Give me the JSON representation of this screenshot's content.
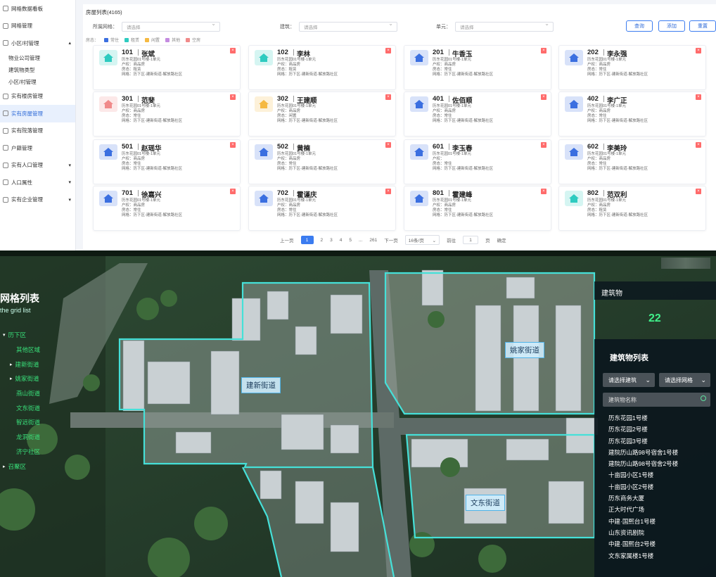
{
  "sidebar": {
    "items": [
      {
        "label": "网格数据看板"
      },
      {
        "label": "网格管理"
      },
      {
        "label": "小区/村管理"
      },
      {
        "label": "物业公司管理"
      },
      {
        "label": "建筑物类型"
      },
      {
        "label": "小区/村管理"
      },
      {
        "label": "实有楼房管理"
      },
      {
        "label": "实有房屋管理"
      },
      {
        "label": "实有院落管理"
      },
      {
        "label": "户籍管理"
      },
      {
        "label": "实有人口管理"
      },
      {
        "label": "人口属性"
      },
      {
        "label": "实有企业管理"
      }
    ]
  },
  "house_list": {
    "title": "房屋列表(4165)",
    "filters": [
      {
        "label": "所属网格：",
        "placeholder": "请选择"
      },
      {
        "label": "建筑：",
        "placeholder": "请选择"
      },
      {
        "label": "单元：",
        "placeholder": "请选择"
      }
    ],
    "buttons": {
      "query": "查询",
      "add": "添加",
      "reset": "重置"
    },
    "legend": {
      "label": "房态：",
      "items": [
        {
          "label": "常住",
          "color": "#3b6fe0"
        },
        {
          "label": "租赁",
          "color": "#2ecbc0"
        },
        {
          "label": "闲置",
          "color": "#f5b942"
        },
        {
          "label": "其他",
          "color": "#c48be0"
        },
        {
          "label": "空房",
          "color": "#f08a8a"
        }
      ]
    },
    "cards": [
      {
        "room": "101",
        "owner": "张斌",
        "type": "租赁",
        "color": "#2ecbc0",
        "lines": [
          "历东花园01号楼-1单元",
          "户权：商品房",
          "房态：租赁",
          "网格：历下区-建新街道-解放路社区"
        ]
      },
      {
        "room": "102",
        "owner": "李林",
        "type": "租赁",
        "color": "#2ecbc0",
        "lines": [
          "历东花园01号楼-1单元",
          "户权：商品房",
          "房态：租赁",
          "网格：历下区-建新街道-解放路社区"
        ]
      },
      {
        "room": "201",
        "owner": "牛香玉",
        "type": "常住",
        "color": "#3b6fe0",
        "lines": [
          "历东花园01号楼-1单元",
          "户权：商品房",
          "房态：常住",
          "网格：历下区-建新街道-解放路社区"
        ]
      },
      {
        "room": "202",
        "owner": "李永强",
        "type": "常住",
        "color": "#3b6fe0",
        "lines": [
          "历东花园01号楼-1单元",
          "户权：商品房",
          "房态：常住",
          "网格：历下区-建新街道-解放路社区"
        ]
      },
      {
        "room": "301",
        "owner": "范斐",
        "type": "空房",
        "color": "#f08a8a",
        "lines": [
          "历东花园01号楼-1单元",
          "户权：商品房",
          "房态：常住",
          "网格：历下区-建新街道-解放路社区"
        ]
      },
      {
        "room": "302",
        "owner": "王建顺",
        "type": "闲置",
        "color": "#f5b942",
        "lines": [
          "历东花园01号楼-1单元",
          "户权：商品房",
          "房态：闲置",
          "网格：历下区-建新街道-解放路社区"
        ]
      },
      {
        "room": "401",
        "owner": "佐佰顺",
        "type": "常住",
        "color": "#3b6fe0",
        "lines": [
          "历东花园01号楼-1单元",
          "户权：商品房",
          "房态：常住",
          "网格：历下区-建新街道-解放路社区"
        ]
      },
      {
        "room": "402",
        "owner": "李广正",
        "type": "常住",
        "color": "#3b6fe0",
        "lines": [
          "历东花园01号楼-1单元",
          "户权：商品房",
          "房态：常住",
          "网格：历下区-建新街道-解放路社区"
        ]
      },
      {
        "room": "501",
        "owner": "赵瑶华",
        "type": "常住",
        "color": "#3b6fe0",
        "lines": [
          "历东花园01号楼-1单元",
          "户权：商品房",
          "房态：常住",
          "网格：历下区-建新街道-解放路社区"
        ]
      },
      {
        "room": "502",
        "owner": "黄楠",
        "type": "常住",
        "color": "#3b6fe0",
        "lines": [
          "历东花园01号楼-1单元",
          "户权：商品房",
          "房态：常住",
          "网格：历下区-建新街道-解放路社区"
        ]
      },
      {
        "room": "601",
        "owner": "李玉春",
        "type": "常住",
        "color": "#3b6fe0",
        "lines": [
          "历东花园01号楼-1单元",
          "户权：",
          "房态：常住",
          "网格：历下区-建新街道-解放路社区"
        ]
      },
      {
        "room": "602",
        "owner": "李美玲",
        "type": "常住",
        "color": "#3b6fe0",
        "lines": [
          "历东花园01号楼-1单元",
          "户权：商品房",
          "房态：常住",
          "网格：历下区-建新街道-解放路社区"
        ]
      },
      {
        "room": "701",
        "owner": "徐嘉兴",
        "type": "常住",
        "color": "#3b6fe0",
        "lines": [
          "历东花园01号楼-1单元",
          "户权：商品房",
          "房态：常住",
          "网格：历下区-建新街道-解放路社区"
        ]
      },
      {
        "room": "702",
        "owner": "霍谨庆",
        "type": "常住",
        "color": "#3b6fe0",
        "lines": [
          "历东花园01号楼-1单元",
          "户权：商品房",
          "房态：常住",
          "网格：历下区-建新街道-解放路社区"
        ]
      },
      {
        "room": "801",
        "owner": "霍建峰",
        "type": "常住",
        "color": "#3b6fe0",
        "lines": [
          "历东花园01号楼-1单元",
          "户权：商品房",
          "房态：常住",
          "网格：历下区-建新街道-解放路社区"
        ]
      },
      {
        "room": "802",
        "owner": "范双利",
        "type": "租赁",
        "color": "#2ecbc0",
        "lines": [
          "历东花园01号楼-1单元",
          "户权：商品房",
          "房态：租赁",
          "网格：历下区-建新街道-解放路社区"
        ]
      }
    ],
    "pagination": {
      "prev": "上一页",
      "pages": [
        "1",
        "2",
        "3",
        "4",
        "5",
        "...",
        "261"
      ],
      "next": "下一页",
      "per_page": "16条/页",
      "goto_label": "前往",
      "goto_value": "1",
      "page_unit": "页",
      "confirm": "确定"
    }
  },
  "map": {
    "grid_title": "网格列表",
    "grid_subtitle": "the grid list",
    "tree": [
      {
        "label": "历下区",
        "level": 0,
        "arrow": "▾"
      },
      {
        "label": "其他区域",
        "level": 1,
        "arrow": ""
      },
      {
        "label": "建新街道",
        "level": 1,
        "arrow": "▸"
      },
      {
        "label": "姚家街道",
        "level": 1,
        "arrow": "▸"
      },
      {
        "label": "燕山街道",
        "level": 1,
        "arrow": ""
      },
      {
        "label": "文东街道",
        "level": 1,
        "arrow": ""
      },
      {
        "label": "智远街道",
        "level": 1,
        "arrow": ""
      },
      {
        "label": "龙洞街道",
        "level": 1,
        "arrow": ""
      },
      {
        "label": "济宁社区",
        "level": 1,
        "arrow": ""
      },
      {
        "label": "召聚区",
        "level": 0,
        "arrow": "▸"
      }
    ],
    "street_labels": {
      "jianxin": "建新街道",
      "yaojia": "姚家街道",
      "wendong": "文东街道"
    },
    "building_header": "建筑物",
    "building_count": "22",
    "building_panel": {
      "title": "建筑物列表",
      "type_select": "请选择建筑",
      "grid_select": "请选择网格",
      "search_placeholder": "建筑物名称",
      "items": [
        "历东花园1号楼",
        "历东花园2号楼",
        "历东花园3号楼",
        "建院历山路98号宿舍1号楼",
        "建院历山路98号宿舍2号楼",
        "十亩园小区1号楼",
        "十亩园小区2号楼",
        "历东商务大厦",
        "正大时代广场",
        "中建·国熙台1号楼",
        "山东资讯剧院",
        "中建·国熙台2号楼",
        "文东家属楼1号楼"
      ]
    }
  }
}
